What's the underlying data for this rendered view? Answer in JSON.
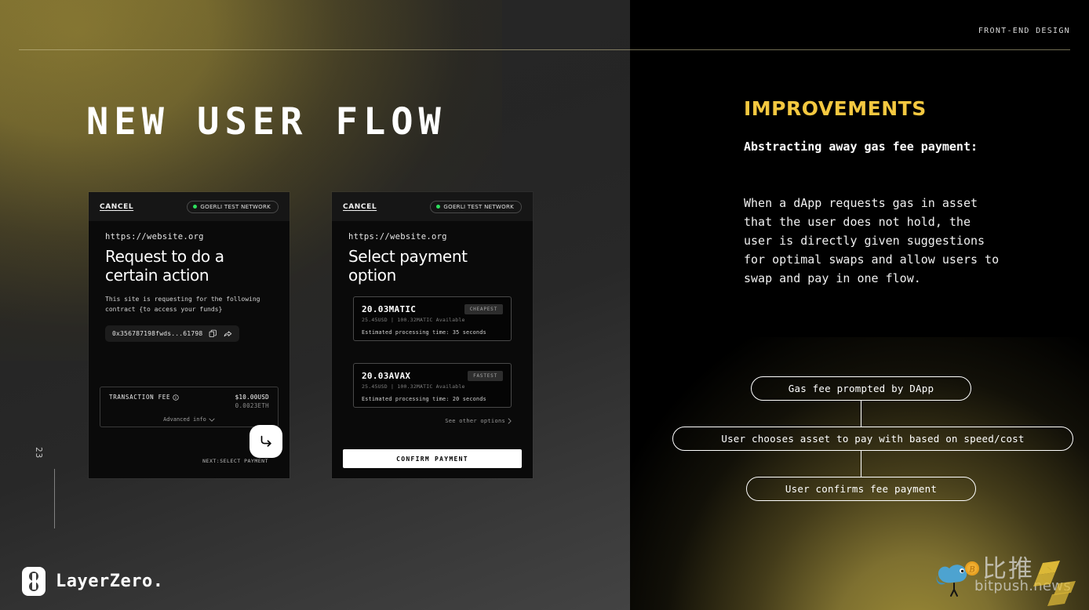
{
  "header": {
    "label": "FRONT-END DESIGN"
  },
  "page": {
    "number": "23",
    "title": "NEW USER FLOW"
  },
  "phone1": {
    "cancel": "CANCEL",
    "network": "GOERLI TEST NETWORK",
    "url": "https://website.org",
    "heading": "Request to do a certain action",
    "subtext": "This site is requesting for the following contract {to access your funds}",
    "address": "0x356787198fwds...61798",
    "copy_icon": "copy-icon",
    "share_icon": "share-icon",
    "fee_label": "TRANSACTION FEE",
    "fee_usd": "$10.00USD",
    "fee_eth": "0.0023ETH",
    "advanced": "Advanced info",
    "next_label": "NEXT:SELECT PAYMENT",
    "fab_icon": "arrow-turn-right-icon"
  },
  "phone2": {
    "cancel": "CANCEL",
    "network": "GOERLI TEST NETWORK",
    "url": "https://website.org",
    "heading": "Select payment option",
    "options": [
      {
        "amount": "20.03MATIC",
        "badge": "CHEAPEST",
        "meta": "25.45USD | 100.32MATIC Available",
        "eta": "Estimated processing time: 35 seconds"
      },
      {
        "amount": "20.03AVAX",
        "badge": "FASTEST",
        "meta": "25.45USD | 100.32MATIC Available",
        "eta": "Estimated processing time: 20 seconds"
      }
    ],
    "see_other": "See other options",
    "confirm": "CONFIRM PAYMENT"
  },
  "improvements": {
    "title": "IMPROVEMENTS",
    "title_color": "#f4c840",
    "lead": "Abstracting away gas fee payment:",
    "body": "When a dApp requests gas in asset that the user does not hold, the user is directly given suggestions for optimal swaps and allow users to swap and pay in one flow.",
    "flow": [
      "Gas fee prompted by DApp",
      "User chooses asset to pay with based on speed/cost",
      "User confirms fee payment"
    ]
  },
  "footer": {
    "brand": "LayerZero."
  },
  "watermark": {
    "cn": "比推",
    "en": "bitpush.news"
  }
}
